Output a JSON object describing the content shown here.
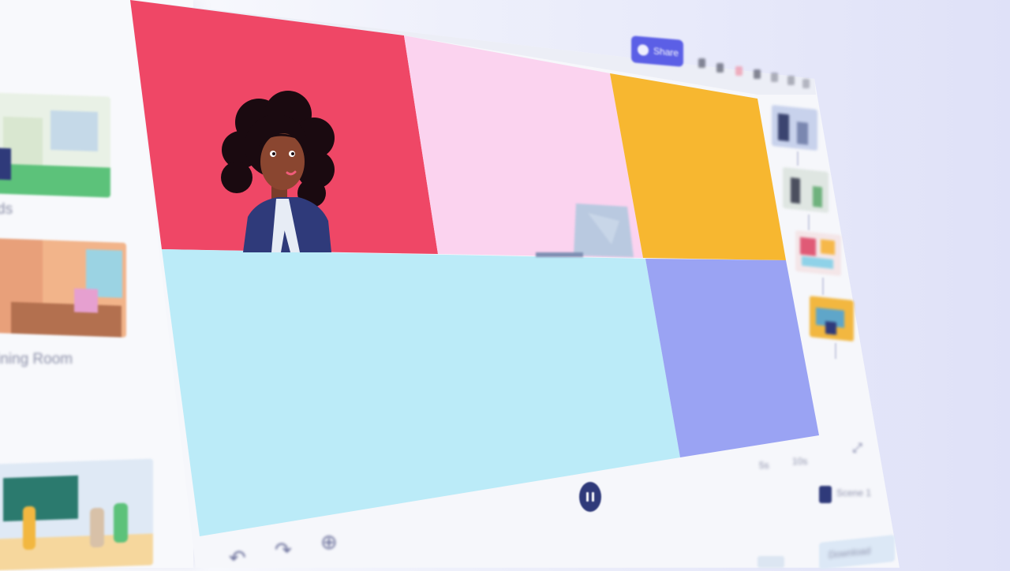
{
  "left_panel": {
    "templates": [
      {
        "label": "ds"
      },
      {
        "label": "ining Room"
      },
      {
        "label": ""
      }
    ]
  },
  "toolbar": {
    "share_label": "Share",
    "icons": [
      "user-icon",
      "lock-icon",
      "heart-icon",
      "download-icon",
      "settings-icon",
      "more-icon",
      "help-icon"
    ]
  },
  "canvas": {
    "cells": [
      {
        "name": "cell-red",
        "color": "#ef4766"
      },
      {
        "name": "cell-pink",
        "color": "#fbd3ef"
      },
      {
        "name": "cell-yellow",
        "color": "#f7b730"
      },
      {
        "name": "cell-lightblue",
        "color": "#bbebf8"
      },
      {
        "name": "cell-purple",
        "color": "#9aa3f3"
      }
    ]
  },
  "playback": {
    "pause_label": "Pause",
    "time_a": "5s",
    "time_b": "10s"
  },
  "footer": {
    "zoom_label": "Scene 1",
    "next_button": "Download"
  }
}
